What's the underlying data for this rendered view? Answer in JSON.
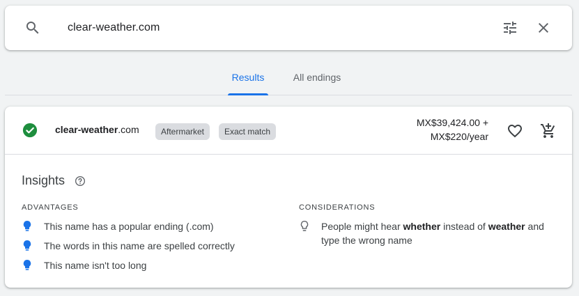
{
  "search": {
    "query": "clear-weather.com",
    "icons": {
      "search": "search-icon",
      "filter": "tune-icon",
      "close": "close-icon"
    }
  },
  "tabs": [
    {
      "label": "Results",
      "active": true
    },
    {
      "label": "All endings",
      "active": false
    }
  ],
  "result": {
    "domain_base": "clear-weather",
    "domain_tld": ".com",
    "status_icon": "check-circle-icon",
    "chips": [
      "Aftermarket",
      "Exact match"
    ],
    "price_line1": "MX$39,424.00 +",
    "price_line2": "MX$220/year",
    "actions": {
      "favorite": "heart-outline-icon",
      "cart": "add-shopping-cart-icon"
    }
  },
  "insights": {
    "title": "Insights",
    "advantages": {
      "heading": "ADVANTAGES",
      "items": [
        "This name has a popular ending (.com)",
        "The words in this name are spelled correctly",
        "This name isn't too long"
      ]
    },
    "considerations": {
      "heading": "CONSIDERATIONS",
      "items": [
        {
          "pre": "People might hear ",
          "bold1": "whether",
          "mid": " instead of ",
          "bold2": "weather",
          "post": " and type the wrong name"
        }
      ]
    }
  },
  "colors": {
    "accent": "#1a73e8",
    "success": "#1e8e3e",
    "chip_bg": "#dadce0",
    "background": "#f1f3f4"
  }
}
